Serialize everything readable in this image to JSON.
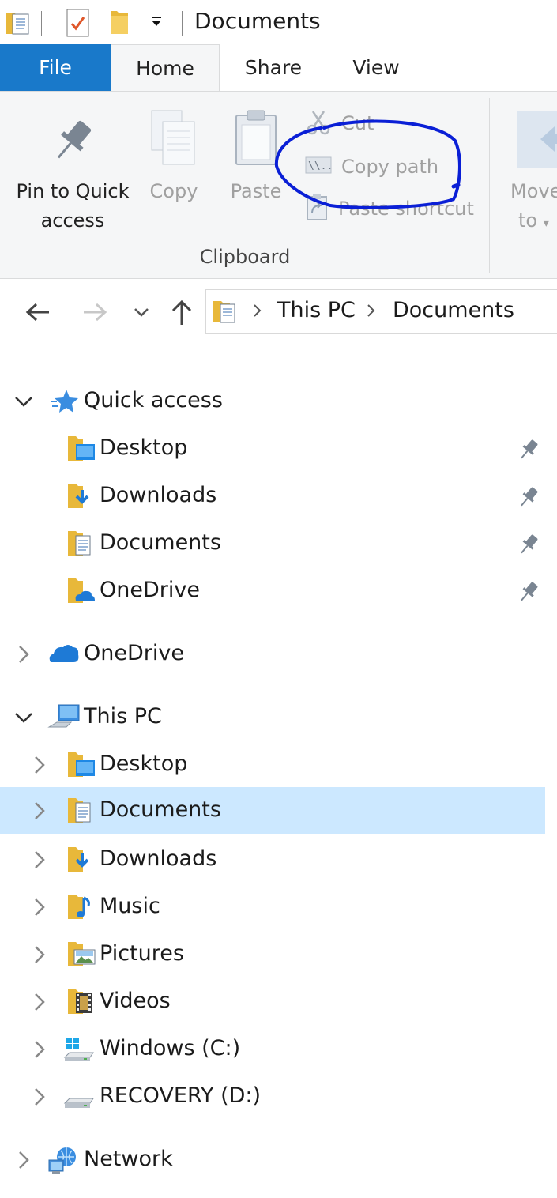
{
  "window": {
    "title": "Documents"
  },
  "ribbon": {
    "tabs": {
      "file": "File",
      "home": "Home",
      "share": "Share",
      "view": "View"
    },
    "clipboard": {
      "group_label": "Clipboard",
      "pin_line1": "Pin to Quick",
      "pin_line2": "access",
      "copy": "Copy",
      "paste": "Paste",
      "cut": "Cut",
      "copy_path": "Copy path",
      "paste_shortcut": "Paste shortcut"
    },
    "organize": {
      "move_line1": "Move",
      "move_line2": "to"
    },
    "annotation_color": "#0a1fd6"
  },
  "address": {
    "crumbs": [
      "This PC",
      "Documents"
    ]
  },
  "tree": {
    "quick_access": {
      "label": "Quick access",
      "items": [
        {
          "label": "Desktop",
          "icon": "desktop-folder-icon",
          "pinned": true
        },
        {
          "label": "Downloads",
          "icon": "downloads-folder-icon",
          "pinned": true
        },
        {
          "label": "Documents",
          "icon": "documents-folder-icon",
          "pinned": true
        },
        {
          "label": "OneDrive",
          "icon": "onedrive-folder-icon",
          "pinned": true
        }
      ]
    },
    "onedrive": {
      "label": "OneDrive"
    },
    "this_pc": {
      "label": "This PC",
      "items": [
        {
          "label": "Desktop",
          "icon": "desktop-folder-icon"
        },
        {
          "label": "Documents",
          "icon": "documents-folder-icon",
          "selected": true
        },
        {
          "label": "Downloads",
          "icon": "downloads-folder-icon"
        },
        {
          "label": "Music",
          "icon": "music-folder-icon"
        },
        {
          "label": "Pictures",
          "icon": "pictures-folder-icon"
        },
        {
          "label": "Videos",
          "icon": "videos-folder-icon"
        },
        {
          "label": "Windows (C:)",
          "icon": "windows-drive-icon"
        },
        {
          "label": "RECOVERY (D:)",
          "icon": "drive-icon"
        }
      ]
    },
    "network": {
      "label": "Network"
    },
    "selection_color": "#cce8ff"
  }
}
